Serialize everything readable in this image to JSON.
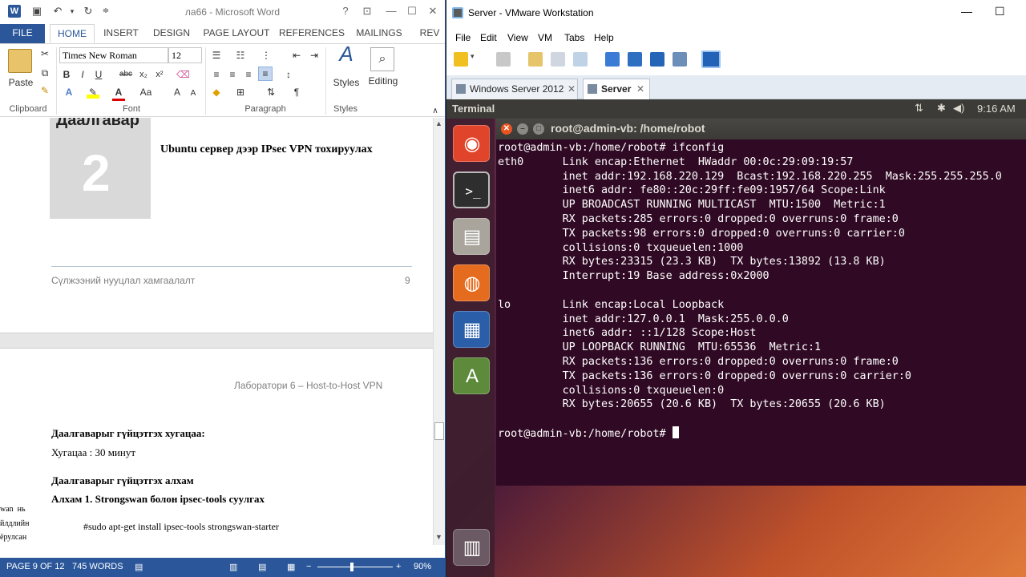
{
  "word": {
    "doc_title": "ла66 - Microsoft Word",
    "tabs": [
      "FILE",
      "HOME",
      "INSERT",
      "DESIGN",
      "PAGE LAYOUT",
      "REFERENCES",
      "MAILINGS",
      "REV"
    ],
    "ribbon": {
      "paste_label": "Paste",
      "font_name": "Times New Roman",
      "font_size": "12",
      "styles_label": "Styles",
      "editing_label": "Editing",
      "group_clipboard": "Clipboard",
      "group_font": "Font",
      "group_paragraph": "Paragraph",
      "group_styles": "Styles"
    },
    "page1": {
      "heading_word": "Даалгавар",
      "big_number": "2",
      "subtitle": "Ubuntu сервер дээр IPsec VPN тохируулах",
      "footer_left": "Сүлжээний нууцлал хамгаалалт",
      "footer_page": "9"
    },
    "page2": {
      "header_right": "Лаборатори 6 – Host-to-Host VPN",
      "line1": "Даалгаварыг гүйцэтгэх хугацаа:",
      "line2": "Хугацаа : 30 минут",
      "line3": "Даалгаварыг гүйцэтгэх алхам",
      "line4": "Алхам 1. Strongswan болон ipsec-tools суулгах",
      "line5": "#sudo apt-get install ipsec-tools strongswan-starter",
      "margin1": "wan  нь",
      "margin2": "йлдлийн",
      "margin3": "ёрулсан"
    },
    "status": {
      "page": "PAGE 9 OF 12",
      "words": "745 WORDS",
      "zoom": "90%"
    }
  },
  "vmware": {
    "title": "Server - VMware Workstation",
    "menu": [
      "File",
      "Edit",
      "View",
      "VM",
      "Tabs",
      "Help"
    ],
    "tabs": [
      {
        "label": "Windows Server 2012"
      },
      {
        "label": "Server"
      }
    ],
    "ubuntu": {
      "app_name": "Terminal",
      "clock": "9:16 AM",
      "terminal_title": "root@admin-vb: /home/robot",
      "lines": [
        "root@admin-vb:/home/robot# ifconfig",
        "eth0      Link encap:Ethernet  HWaddr 00:0c:29:09:19:57",
        "          inet addr:192.168.220.129  Bcast:192.168.220.255  Mask:255.255.255.0",
        "          inet6 addr: fe80::20c:29ff:fe09:1957/64 Scope:Link",
        "          UP BROADCAST RUNNING MULTICAST  MTU:1500  Metric:1",
        "          RX packets:285 errors:0 dropped:0 overruns:0 frame:0",
        "          TX packets:98 errors:0 dropped:0 overruns:0 carrier:0",
        "          collisions:0 txqueuelen:1000",
        "          RX bytes:23315 (23.3 KB)  TX bytes:13892 (13.8 KB)",
        "          Interrupt:19 Base address:0x2000",
        "",
        "lo        Link encap:Local Loopback",
        "          inet addr:127.0.0.1  Mask:255.0.0.0",
        "          inet6 addr: ::1/128 Scope:Host",
        "          UP LOOPBACK RUNNING  MTU:65536  Metric:1",
        "          RX packets:136 errors:0 dropped:0 overruns:0 frame:0",
        "          TX packets:136 errors:0 dropped:0 overruns:0 carrier:0",
        "          collisions:0 txqueuelen:0",
        "          RX bytes:20655 (20.6 KB)  TX bytes:20655 (20.6 KB)",
        ""
      ],
      "prompt": "root@admin-vb:/home/robot# "
    }
  }
}
